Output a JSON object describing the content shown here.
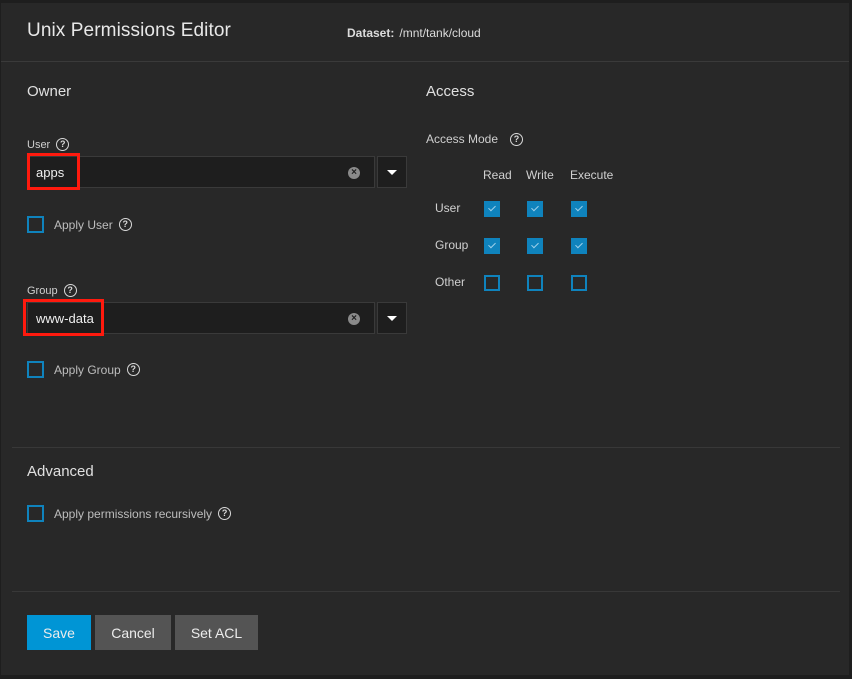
{
  "header": {
    "title": "Unix Permissions Editor",
    "dataset_label": "Dataset:",
    "dataset_path": "/mnt/tank/cloud"
  },
  "owner": {
    "section_title": "Owner",
    "user": {
      "label": "User",
      "value": "apps",
      "apply_label": "Apply User",
      "apply_checked": false
    },
    "group": {
      "label": "Group",
      "value": "www-data",
      "apply_label": "Apply Group",
      "apply_checked": false
    }
  },
  "access": {
    "section_title": "Access",
    "mode_label": "Access Mode",
    "columns": [
      "Read",
      "Write",
      "Execute"
    ],
    "rows": [
      {
        "label": "User",
        "values": [
          true,
          true,
          true
        ]
      },
      {
        "label": "Group",
        "values": [
          true,
          true,
          true
        ]
      },
      {
        "label": "Other",
        "values": [
          false,
          false,
          false
        ]
      }
    ]
  },
  "advanced": {
    "section_title": "Advanced",
    "recursive_label": "Apply permissions recursively",
    "recursive_checked": false
  },
  "actions": {
    "save": "Save",
    "cancel": "Cancel",
    "set_acl": "Set ACL"
  },
  "colors": {
    "accent": "#0095d5",
    "checkbox": "#0f83bd",
    "highlight": "#ff1a0e"
  },
  "icons": {
    "help": "?",
    "clear": "×"
  }
}
